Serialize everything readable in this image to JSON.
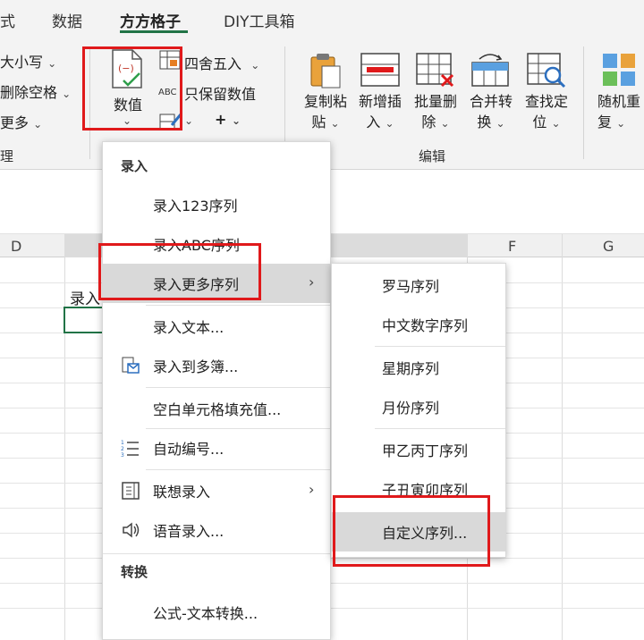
{
  "tabs": [
    {
      "label": "式"
    },
    {
      "label": "数据"
    },
    {
      "label": "方方格子"
    },
    {
      "label": "DIY工具箱"
    }
  ],
  "ribbon": {
    "left_items": {
      "case": "大小写",
      "trim": "删除空格",
      "more": "更多",
      "group_fragment": "理"
    },
    "value_button": "数值",
    "rounding": "四舍五入",
    "keep_values": "只保留数值",
    "plus": "+",
    "edit_group": {
      "label": "编辑",
      "buttons": [
        {
          "line1": "复制粘",
          "line2": "贴"
        },
        {
          "line1": "新增插",
          "line2": "入"
        },
        {
          "line1": "批量删",
          "line2": "除"
        },
        {
          "line1": "合并转",
          "line2": "换"
        },
        {
          "line1": "查找定",
          "line2": "位"
        }
      ]
    },
    "random": {
      "line1": "随机重",
      "line2": "复"
    },
    "chevron": "⌄"
  },
  "sheet": {
    "columns": [
      "D",
      "F",
      "G"
    ],
    "cell_text": "录入"
  },
  "menu": {
    "section_input": "录入",
    "items": [
      {
        "label": "录入123序列"
      },
      {
        "label": "录入ABC序列"
      },
      {
        "label": "录入更多序列"
      },
      {
        "label": "录入文本..."
      },
      {
        "label": "录入到多簿..."
      },
      {
        "label": "空白单元格填充值..."
      },
      {
        "label": "自动编号..."
      },
      {
        "label": "联想录入"
      },
      {
        "label": "语音录入..."
      }
    ],
    "section_convert": "转换",
    "convert_items": [
      {
        "label": "公式-文本转换..."
      }
    ]
  },
  "submenu": {
    "items": [
      {
        "label": "罗马序列"
      },
      {
        "label": "中文数字序列"
      },
      {
        "label": "星期序列"
      },
      {
        "label": "月份序列"
      },
      {
        "label": "甲乙丙丁序列"
      },
      {
        "label": "子丑寅卯序列"
      },
      {
        "label": "自定义序列..."
      }
    ]
  },
  "colors": {
    "accent": "#217346",
    "highlight_box": "#e0191b",
    "menu_hover": "#d9d9d9"
  }
}
